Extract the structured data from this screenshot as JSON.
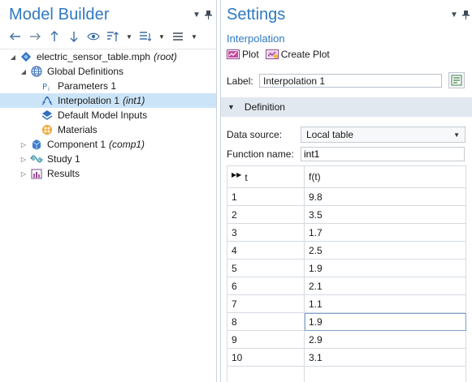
{
  "model_builder": {
    "title": "Model Builder",
    "tree": [
      {
        "label": "electric_sensor_table.mph",
        "tag": "(root)",
        "icon": "mph-file-icon",
        "expander": "expanded",
        "depth": 0
      },
      {
        "label": "Global Definitions",
        "tag": "",
        "icon": "globe-icon",
        "expander": "expanded",
        "depth": 1
      },
      {
        "label": "Parameters 1",
        "tag": "",
        "icon": "parameters-icon",
        "expander": "none",
        "depth": 2
      },
      {
        "label": "Interpolation 1",
        "tag": "(int1)",
        "icon": "interpolation-icon",
        "expander": "none",
        "depth": 2,
        "selected": true
      },
      {
        "label": "Default Model Inputs",
        "tag": "",
        "icon": "default-model-inputs-icon",
        "expander": "none",
        "depth": 2
      },
      {
        "label": "Materials",
        "tag": "",
        "icon": "materials-icon",
        "expander": "none",
        "depth": 2
      },
      {
        "label": "Component 1",
        "tag": "(comp1)",
        "icon": "component-icon",
        "expander": "collapsed",
        "depth": 1
      },
      {
        "label": "Study 1",
        "tag": "",
        "icon": "study-icon",
        "expander": "collapsed",
        "depth": 1
      },
      {
        "label": "Results",
        "tag": "",
        "icon": "results-icon",
        "expander": "collapsed",
        "depth": 1
      }
    ]
  },
  "settings": {
    "title": "Settings",
    "subtitle": "Interpolation",
    "plot_label": "Plot",
    "create_plot_label": "Create Plot",
    "label_caption": "Label:",
    "label_value": "Interpolation 1",
    "section_title": "Definition",
    "data_source_caption": "Data source:",
    "data_source_value": "Local table",
    "function_name_caption": "Function name:",
    "function_name_value": "int1",
    "table": {
      "headers": [
        "t",
        "f(t)"
      ],
      "rows": [
        [
          "1",
          "9.8"
        ],
        [
          "2",
          "3.5"
        ],
        [
          "3",
          "1.7"
        ],
        [
          "4",
          "2.5"
        ],
        [
          "5",
          "1.9"
        ],
        [
          "6",
          "2.1"
        ],
        [
          "7",
          "1.1"
        ],
        [
          "8",
          "1.9"
        ],
        [
          "9",
          "2.9"
        ],
        [
          "10",
          "3.1"
        ],
        [
          "",
          ""
        ]
      ]
    }
  },
  "colors": {
    "accent": "#2f79c1",
    "selection": "#cce4f7",
    "section_header": "#e1e8f0"
  }
}
